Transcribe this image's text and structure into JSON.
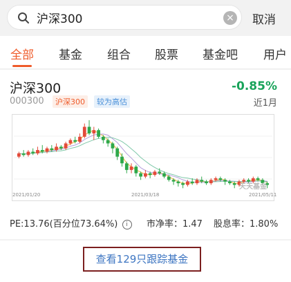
{
  "search": {
    "value": "沪深300",
    "cancel_label": "取消"
  },
  "tabs": [
    {
      "label": "全部",
      "active": true
    },
    {
      "label": "基金"
    },
    {
      "label": "组合"
    },
    {
      "label": "股票"
    },
    {
      "label": "基金吧"
    },
    {
      "label": "用户"
    }
  ],
  "fund": {
    "name": "沪深300",
    "code": "000300",
    "tags": [
      "沪深300",
      "较为高估"
    ],
    "change": "-0.85%",
    "period": "近1月"
  },
  "chart_data": {
    "type": "candlestick",
    "x_tick_labels": [
      "2021/01/20",
      "2021/03/18",
      "2021/05/11"
    ],
    "watermark": "天天基金",
    "colors": {
      "up": "#e34a3a",
      "down": "#2ea84a",
      "ma1": "#f2b233",
      "ma2": "#b39ddb",
      "ma3": "#7fc8a9"
    },
    "candles": [
      [
        50,
        52,
        49,
        53
      ],
      [
        52,
        51,
        50,
        54
      ],
      [
        51,
        53,
        50,
        54
      ],
      [
        53,
        52,
        51,
        55
      ],
      [
        52,
        54,
        51,
        56
      ],
      [
        54,
        53,
        52,
        57
      ],
      [
        53,
        55,
        52,
        56
      ],
      [
        55,
        54,
        53,
        57
      ],
      [
        54,
        56,
        53,
        58
      ],
      [
        56,
        55,
        54,
        57
      ],
      [
        55,
        58,
        54,
        59
      ],
      [
        58,
        60,
        57,
        61
      ],
      [
        60,
        59,
        58,
        62
      ],
      [
        59,
        62,
        58,
        64
      ],
      [
        62,
        68,
        61,
        70
      ],
      [
        68,
        64,
        63,
        72
      ],
      [
        64,
        66,
        60,
        68
      ],
      [
        66,
        62,
        61,
        67
      ],
      [
        62,
        60,
        58,
        63
      ],
      [
        60,
        58,
        56,
        61
      ],
      [
        58,
        55,
        52,
        59
      ],
      [
        55,
        50,
        48,
        56
      ],
      [
        50,
        46,
        44,
        52
      ],
      [
        46,
        42,
        40,
        47
      ],
      [
        42,
        44,
        40,
        46
      ],
      [
        44,
        40,
        38,
        45
      ],
      [
        40,
        38,
        36,
        41
      ],
      [
        38,
        40,
        37,
        42
      ],
      [
        40,
        39,
        37,
        41
      ],
      [
        39,
        41,
        38,
        42
      ],
      [
        41,
        40,
        39,
        43
      ],
      [
        40,
        38,
        37,
        41
      ],
      [
        38,
        36,
        35,
        39
      ],
      [
        36,
        35,
        33,
        37
      ],
      [
        35,
        34,
        32,
        36
      ],
      [
        34,
        33,
        31,
        35
      ],
      [
        33,
        35,
        32,
        36
      ],
      [
        35,
        34,
        33,
        37
      ],
      [
        34,
        36,
        33,
        37
      ],
      [
        36,
        35,
        34,
        38
      ],
      [
        35,
        34,
        33,
        36
      ],
      [
        34,
        36,
        33,
        37
      ],
      [
        36,
        37,
        35,
        38
      ],
      [
        37,
        36,
        35,
        38
      ],
      [
        36,
        35,
        33,
        37
      ],
      [
        35,
        34,
        33,
        36
      ],
      [
        34,
        33,
        31,
        35
      ],
      [
        33,
        35,
        32,
        36
      ],
      [
        35,
        36,
        34,
        37
      ],
      [
        36,
        35,
        34,
        37
      ],
      [
        35,
        37,
        34,
        38
      ],
      [
        37,
        36,
        35,
        38
      ],
      [
        36,
        34,
        33,
        37
      ],
      [
        34,
        33,
        31,
        35
      ]
    ]
  },
  "stats": {
    "pe": "PE:13.76(百分位73.64%)",
    "pb": "市净率：1.47",
    "dividend": "股息率：1.80%"
  },
  "footer": {
    "link_label": "查看129只跟踪基金"
  }
}
